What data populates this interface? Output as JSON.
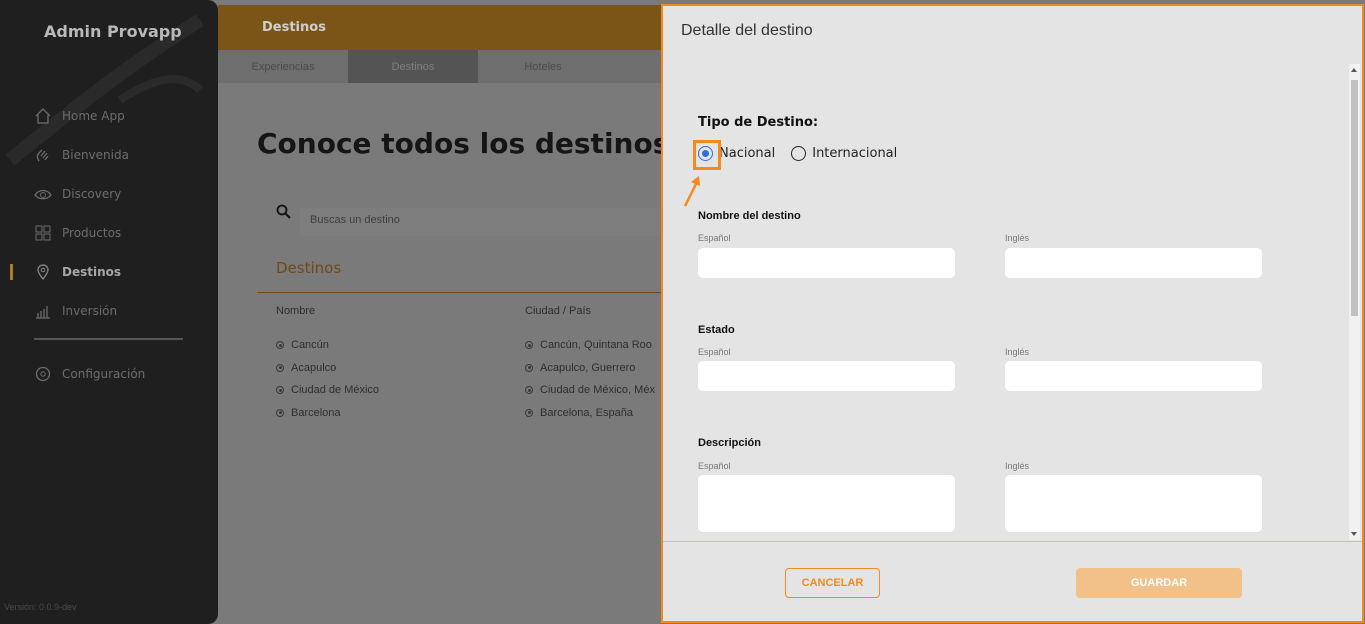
{
  "sidebar": {
    "brand": "Admin Provapp",
    "items": [
      {
        "label": "Home App",
        "icon": "home-icon"
      },
      {
        "label": "Bienvenida",
        "icon": "wave-hand-icon"
      },
      {
        "label": "Discovery",
        "icon": "eye-icon"
      },
      {
        "label": "Productos",
        "icon": "grid-icon"
      },
      {
        "label": "Destinos",
        "icon": "location-pin-icon",
        "active": true
      },
      {
        "label": "Inversión",
        "icon": "bar-chart-icon"
      }
    ],
    "config": {
      "label": "Configuración",
      "icon": "gear-icon"
    },
    "version": "Versión: 0.0.9-dev"
  },
  "topbar": {
    "title": "Destinos"
  },
  "tabs": [
    "Experiencias",
    "Destinos",
    "Hoteles"
  ],
  "page": {
    "heading": "Conoce todos los destinos q",
    "search_placeholder": "Buscas un destino",
    "section_title": "Destinos",
    "columns": [
      "Nombre",
      "Ciudad / País"
    ],
    "rows": [
      {
        "name": "Cancún",
        "city": "Cancún, Quintana Roo"
      },
      {
        "name": "Acapulco",
        "city": "Acapulco, Guerrero"
      },
      {
        "name": "Ciudad de México",
        "city": "Ciudad de México, Méx"
      },
      {
        "name": "Barcelona",
        "city": "Barcelona, España"
      }
    ]
  },
  "modal": {
    "title": "Detalle del destino",
    "type_label": "Tipo de Destino:",
    "options": [
      "Nacional",
      "Internacional"
    ],
    "selected": "Nacional",
    "fields": [
      {
        "label": "Nombre del destino",
        "es": "Español",
        "en": "Inglés",
        "es_value": "",
        "en_value": ""
      },
      {
        "label": "Estado",
        "es": "Español",
        "en": "Inglés",
        "es_value": "",
        "en_value": ""
      },
      {
        "label": "Descripción",
        "es": "Español",
        "en": "Inglés",
        "es_value": "",
        "en_value": ""
      }
    ],
    "cancel_label": "CANCELAR",
    "save_label": "GUARDAR"
  },
  "colors": {
    "accent": "#f28a1d",
    "radio": "#2f6fd8",
    "sidebar": "#1f1f1f"
  }
}
